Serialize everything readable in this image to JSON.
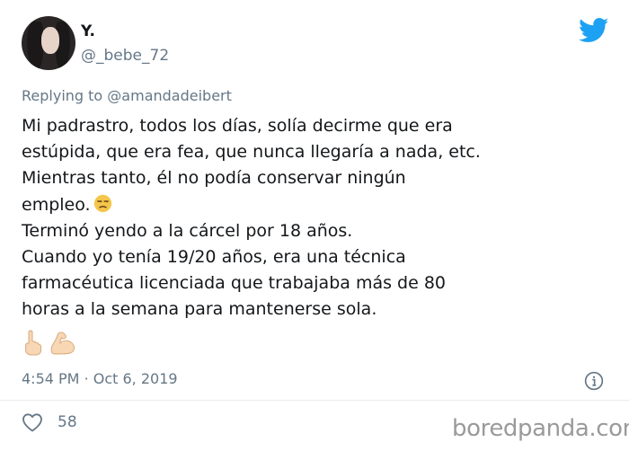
{
  "author": {
    "name": "Y.",
    "handle": "@_bebe_72"
  },
  "reply": {
    "prefix": "Replying to",
    "to": "@amandadeibert"
  },
  "tweet": {
    "lines": [
      "Mi padrastro, todos los días, solía decirme que era",
      "estúpida, que era fea, que nunca llegaría a nada, etc.",
      "Mientras tanto, él no podía conservar ningún",
      "empleo.",
      "Terminó yendo a la cárcel por 18 años.",
      "Cuando yo tenía 19/20 años, era una técnica",
      "farmacéutica licenciada que trabajaba más de 80",
      "horas a la semana para mantenerse sola."
    ],
    "inline_emoji": "unamused-face",
    "trailing_emojis": [
      "middle-finger",
      "flexed-biceps"
    ]
  },
  "meta": {
    "time": "4:54 PM",
    "separator": "·",
    "date": "Oct 6, 2019"
  },
  "engagement": {
    "likes": "58"
  },
  "watermark": "boredpanda.com",
  "colors": {
    "twitter_blue": "#1da1f2",
    "text": "#14171a",
    "secondary": "#657786"
  }
}
